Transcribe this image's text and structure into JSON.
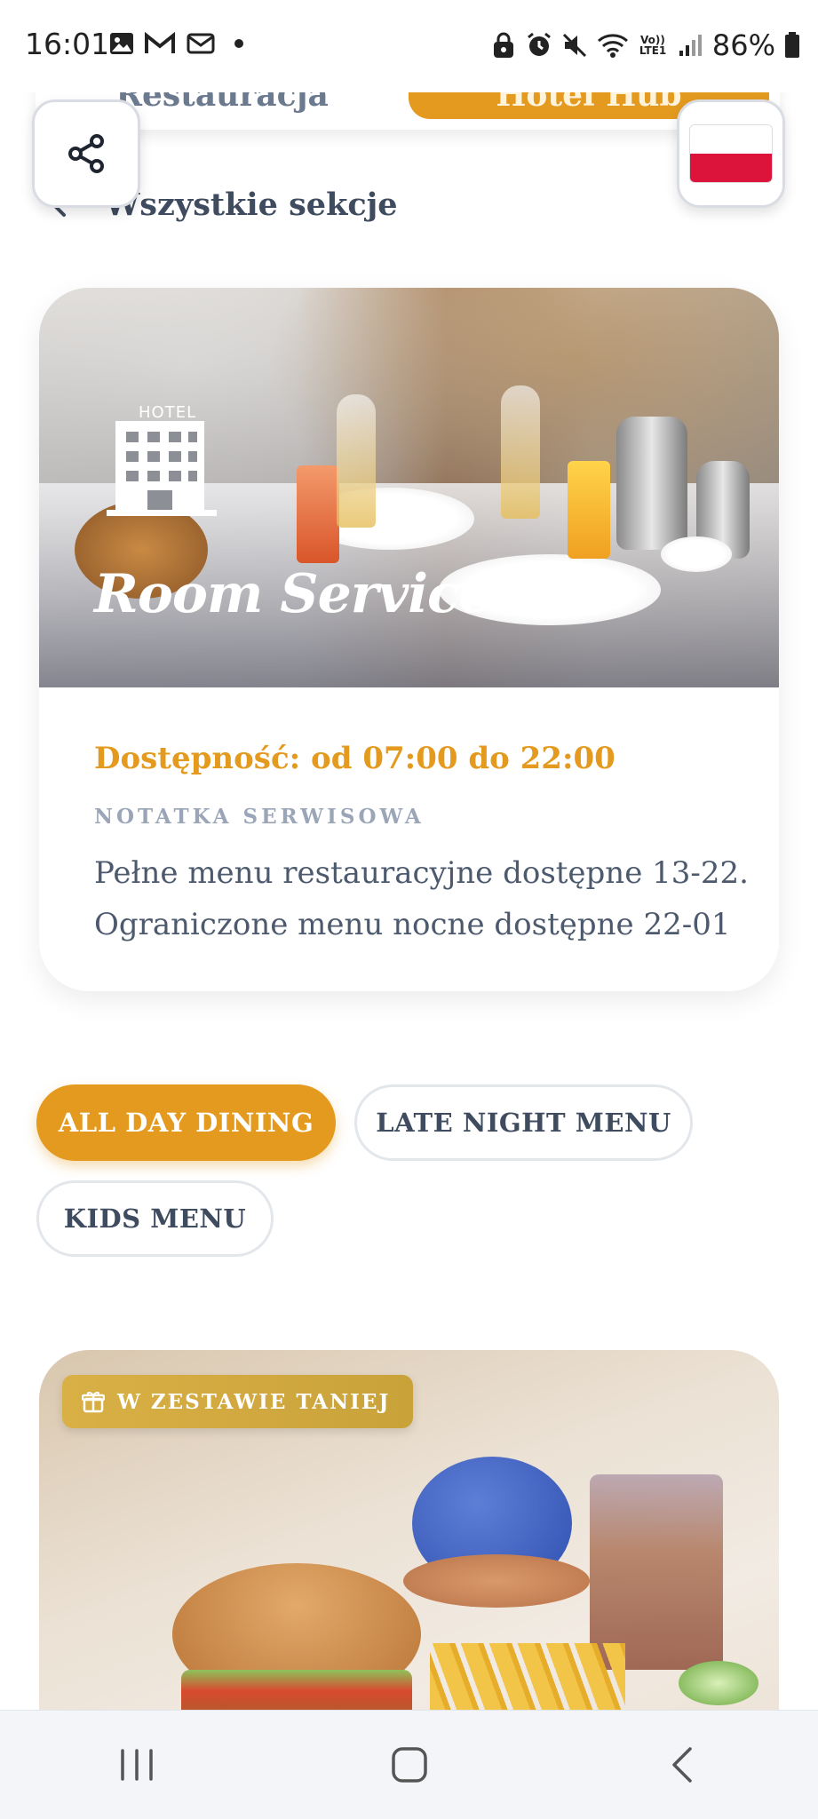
{
  "status_bar": {
    "time": "16:01",
    "battery": "86%",
    "left_icons": [
      "image-icon",
      "gmail-icon",
      "gmail-icon",
      "dot-icon"
    ],
    "right_icons": [
      "lock-icon",
      "alarm-icon",
      "mute-icon",
      "wifi-icon",
      "volte-icon",
      "signal-icon",
      "battery-icon"
    ],
    "volte_label": "Vo)) LTE1"
  },
  "top_tabs": {
    "left_label": "Restauracja",
    "right_label": "Hotel Hub"
  },
  "language": {
    "current": "pl",
    "flag_colors": [
      "#ffffff",
      "#dc143c"
    ]
  },
  "back_link": {
    "label": "Wszystkie sekcje"
  },
  "section": {
    "hotel_word": "HOTEL",
    "title": "Room Service",
    "availability": "Dostępność: od 07:00 do 22:00",
    "note_label": "NOTATKA SERWISOWA",
    "note_lines": [
      "Pełne menu restauracyjne dostępne 13-22.",
      "Ograniczone menu nocne dostępne 22-01"
    ]
  },
  "menus": [
    {
      "label": "ALL DAY DINING",
      "active": true
    },
    {
      "label": "LATE NIGHT MENU",
      "active": false
    },
    {
      "label": "KIDS MENU",
      "active": false
    }
  ],
  "food_card": {
    "badge": "W ZESTAWIE TANIEJ",
    "badge_icon": "gift-icon"
  },
  "colors": {
    "accent": "#e39a1f",
    "gold_badge": "#d4ab40",
    "text_dark": "#3f4b5e",
    "text_muted": "#9aa6b8"
  },
  "navbar": {
    "buttons": [
      "recent-apps",
      "home",
      "back"
    ]
  }
}
